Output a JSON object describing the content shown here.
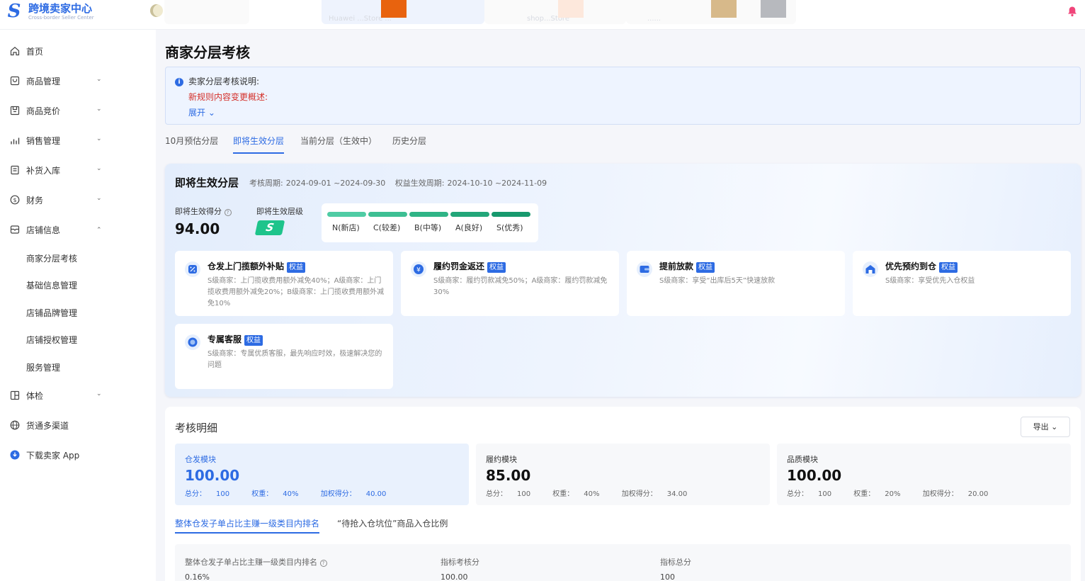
{
  "app": {
    "title": "跨境卖家中心",
    "subtitle": "Cross-border Seller Center"
  },
  "topbar": {
    "shop_tabs": [
      {
        "label": "Huawei ...Store ..."
      },
      {
        "label": "shop...Store"
      },
      {
        "label": "......"
      }
    ],
    "icons": [
      "moon-icon",
      "bell-icon"
    ]
  },
  "sidebar": {
    "items": [
      {
        "label": "首页",
        "icon": "home-icon"
      },
      {
        "label": "商品管理",
        "icon": "product-icon"
      },
      {
        "label": "商品竞价",
        "icon": "bid-icon"
      },
      {
        "label": "销售管理",
        "icon": "chart-icon"
      },
      {
        "label": "补货入库",
        "icon": "restock-icon"
      },
      {
        "label": "财务",
        "icon": "dollar-icon"
      },
      {
        "label": "店铺信息",
        "icon": "shop-icon"
      },
      {
        "label": "体检",
        "icon": "checkup-icon"
      },
      {
        "label": "货通多渠道",
        "icon": "globe-icon"
      },
      {
        "label": "下载卖家 App",
        "icon": "download-icon"
      }
    ],
    "sub_items": [
      "商家分层考核",
      "基础信息管理",
      "店铺品牌管理",
      "店铺授权管理",
      "服务管理"
    ]
  },
  "page": {
    "title": "商家分层考核"
  },
  "notice": {
    "line1": "卖家分层考核说明:",
    "line2": "新规则内容变更概述:",
    "expand": "展开"
  },
  "tabs": [
    {
      "label": "10月预估分层"
    },
    {
      "label": "即将生效分层"
    },
    {
      "label": "当前分层（生效中）"
    },
    {
      "label": "历史分层"
    }
  ],
  "tier": {
    "title": "即将生效分层",
    "assess_label": "考核周期:",
    "assess_period": "2024-09-01 ~2024-09-30",
    "benefit_label": "权益生效周期:",
    "benefit_period": "2024-10-10 ~2024-11-09",
    "score_label": "即将生效得分",
    "score": "94.00",
    "level_label": "即将生效层级",
    "level": "S",
    "scale": [
      {
        "label": "N(新店)",
        "color": "#4fcca4"
      },
      {
        "label": "C(较差)",
        "color": "#3dbf93"
      },
      {
        "label": "B(中等)",
        "color": "#2fb486"
      },
      {
        "label": "A(良好)",
        "color": "#22a679"
      },
      {
        "label": "S(优秀)",
        "color": "#17996d"
      }
    ],
    "benefit_tag": "权益",
    "benefits": [
      {
        "title": "仓发上门揽额外补贴",
        "desc": "S级商家：上门揽收费用额外减免40%；A级商家：上门揽收费用额外减免20%；B级商家：上门揽收费用额外减免10%",
        "icon": "discount-icon",
        "color": "#2d6be3"
      },
      {
        "title": "履约罚金返还",
        "desc": "S级商家：履约罚款减免50%；A级商家：履约罚款减免30%",
        "icon": "yen-icon",
        "color": "#2d6be3"
      },
      {
        "title": "提前放款",
        "desc": "S级商家：享受“出库后5天”快速放款",
        "icon": "wallet-icon",
        "color": "#2d6be3"
      },
      {
        "title": "优先预约到仓",
        "desc": "S级商家：享受优先入仓权益",
        "icon": "warehouse-icon",
        "color": "#2d6be3"
      },
      {
        "title": "专属客服",
        "desc": "S级商家：专属优质客服，最先响应时效，极速解决您的问题",
        "icon": "service-icon",
        "color": "#2d6be3"
      }
    ]
  },
  "detail": {
    "title": "考核明细",
    "export": "导出",
    "total_label": "总分：",
    "weight_label": "权重：",
    "weighted_label": "加权得分：",
    "modules": [
      {
        "name": "仓发模块",
        "score": "100.00",
        "total": "100",
        "weight": "40%",
        "weighted": "40.00"
      },
      {
        "name": "履约模块",
        "score": "85.00",
        "total": "100",
        "weight": "40%",
        "weighted": "34.00"
      },
      {
        "name": "品质模块",
        "score": "100.00",
        "total": "100",
        "weight": "20%",
        "weighted": "20.00"
      }
    ],
    "sub_tabs": [
      {
        "label": "整体仓发子单占比主赚一级类目内排名"
      },
      {
        "label": "“待抢入仓坑位”商品入仓比例"
      }
    ],
    "metric": {
      "name": "整体仓发子单占比主赚一级类目内排名",
      "value": "0.16%",
      "assess_label": "指标考核分",
      "assess_value": "100.00",
      "total_label": "指标总分",
      "total_value": "100"
    }
  }
}
